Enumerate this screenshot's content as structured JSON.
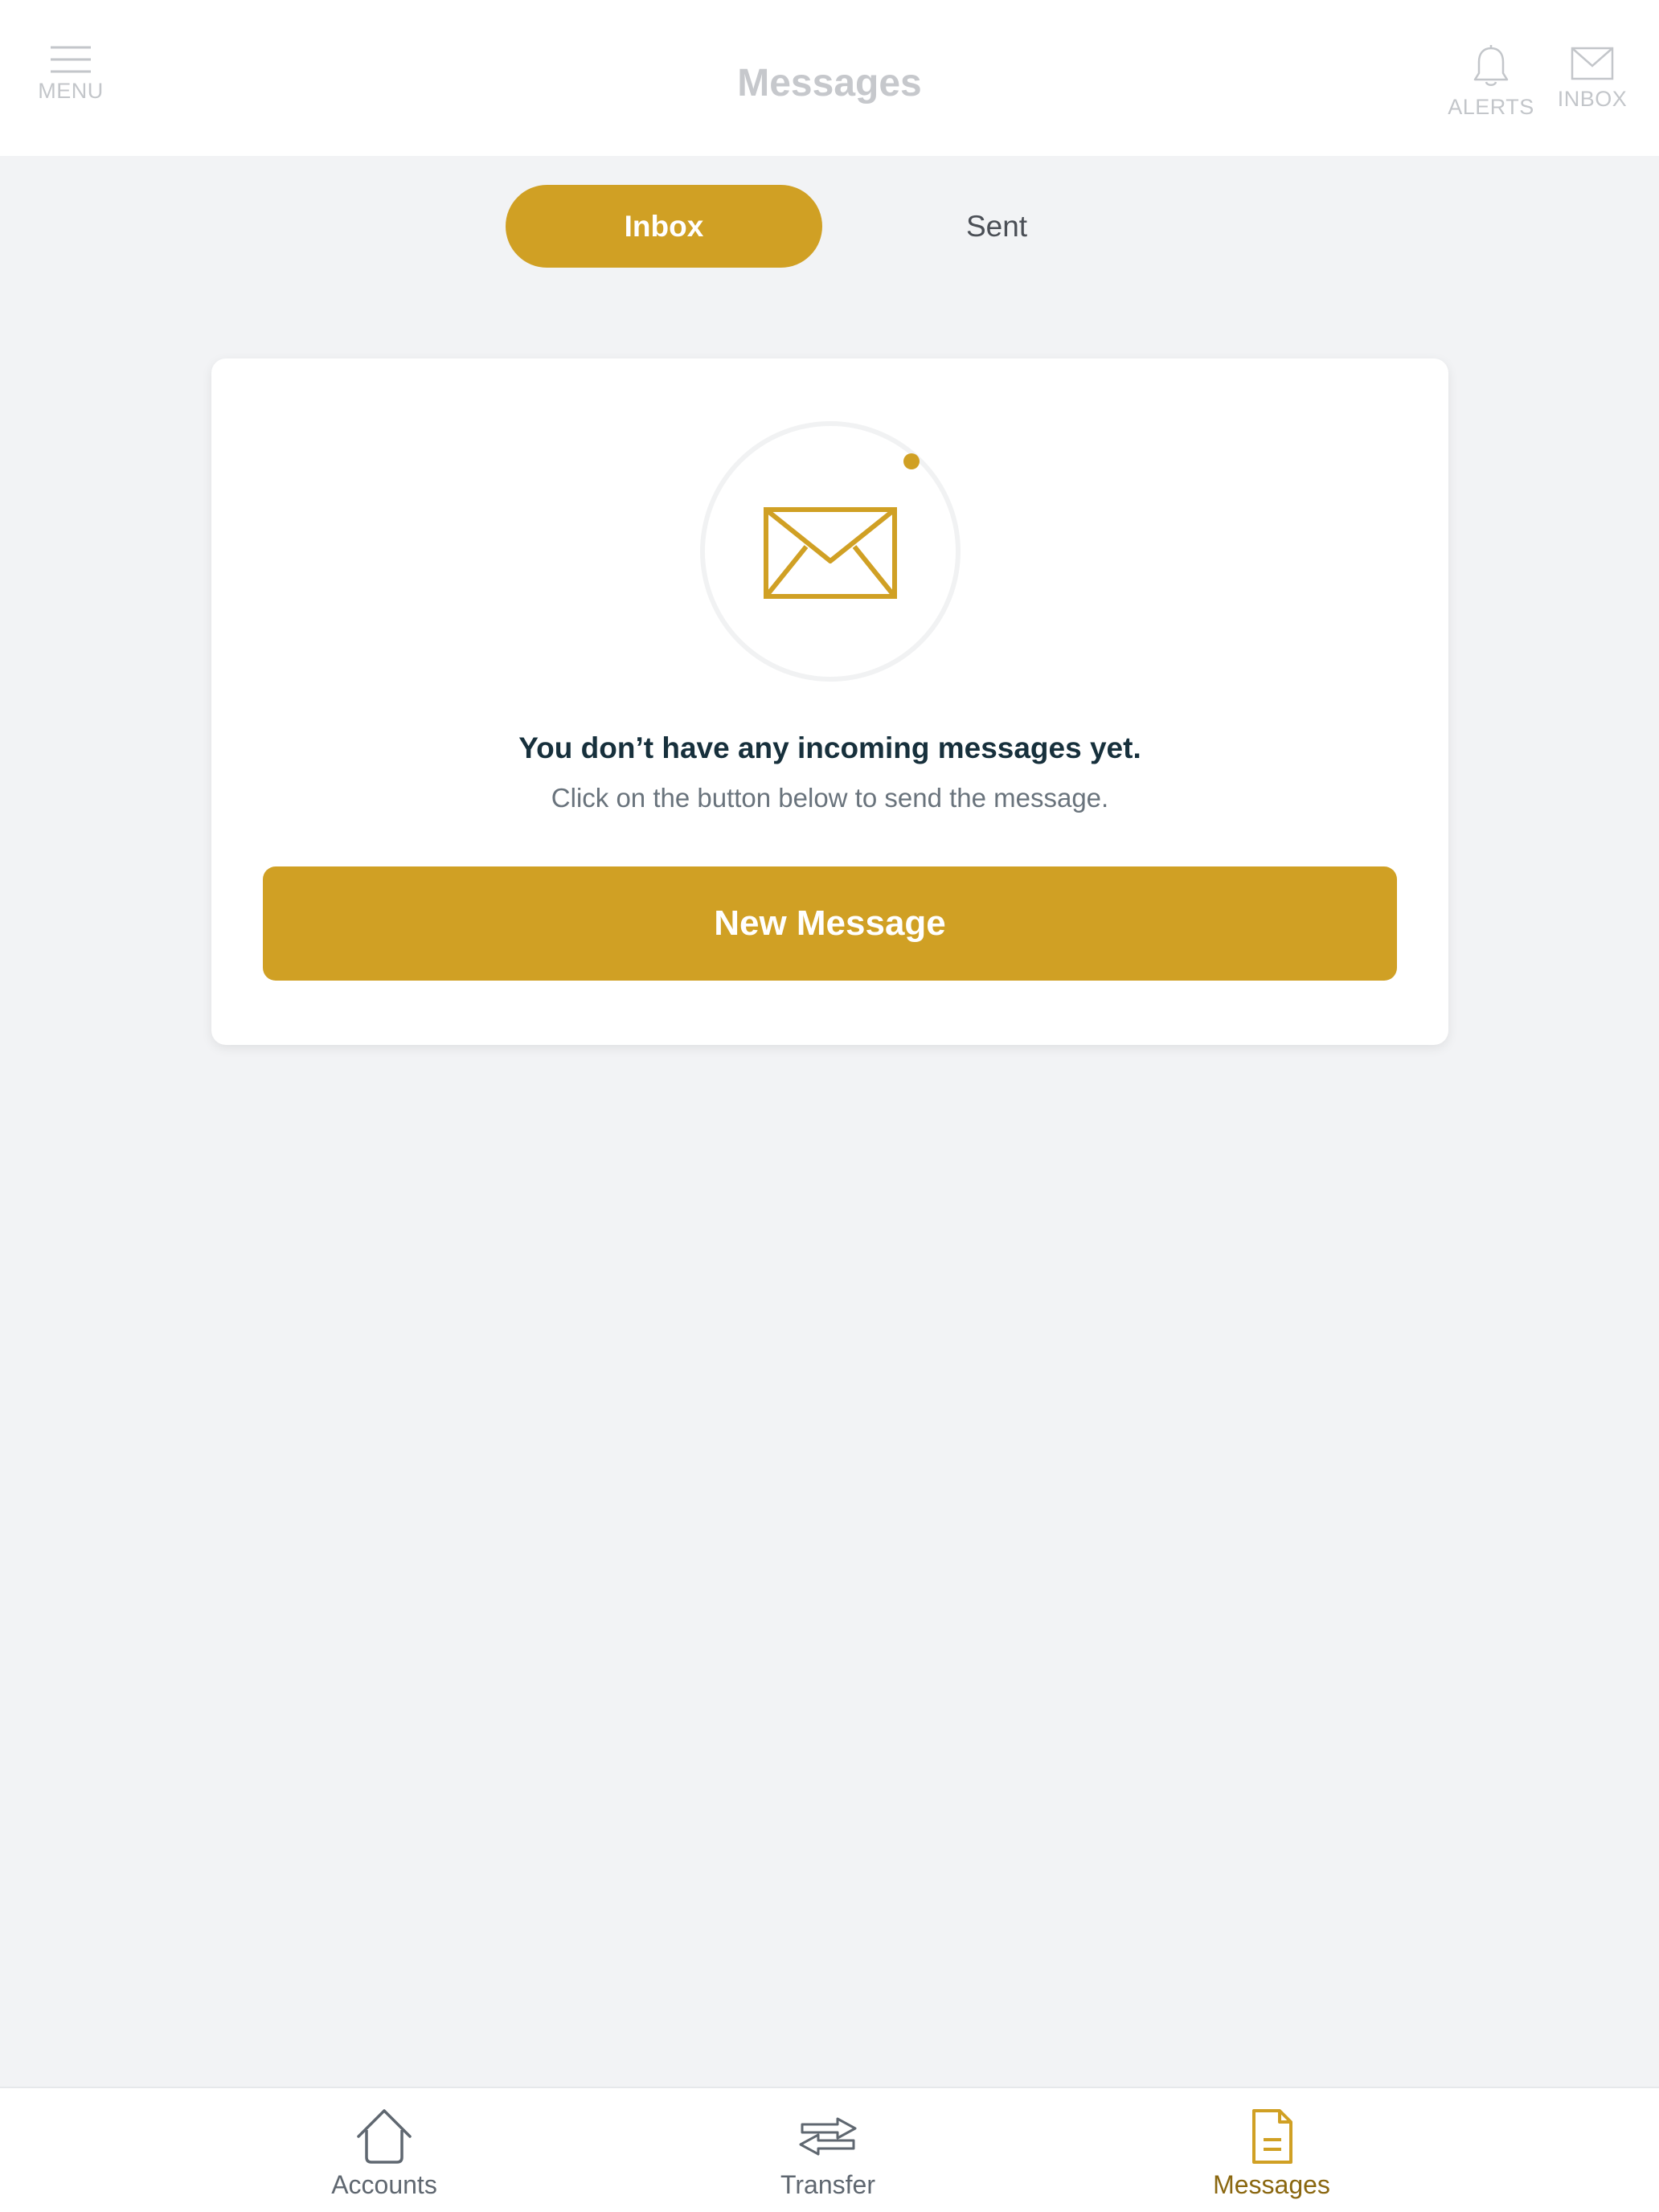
{
  "header": {
    "title": "Messages",
    "menu_label": "MENU",
    "alerts_label": "ALERTS",
    "inbox_label": "INBOX"
  },
  "tabs": [
    {
      "label": "Inbox",
      "active": true
    },
    {
      "label": "Sent",
      "active": false
    }
  ],
  "empty_state": {
    "title": "You don’t have any incoming messages yet.",
    "subtitle": "Click on the button below to send the message.",
    "button_label": "New Message",
    "icon": "envelope-icon"
  },
  "bottom_nav": {
    "items": [
      {
        "label": "Accounts",
        "icon": "home-icon",
        "active": false
      },
      {
        "label": "Transfer",
        "icon": "transfer-arrows-icon",
        "active": false
      },
      {
        "label": "Messages",
        "icon": "document-icon",
        "active": true
      }
    ]
  },
  "colors": {
    "accent": "#d0a024",
    "background": "#f2f3f5",
    "header_text": "#c6c8cc",
    "title_text": "#17303c",
    "active_nav": "#8a6710"
  }
}
